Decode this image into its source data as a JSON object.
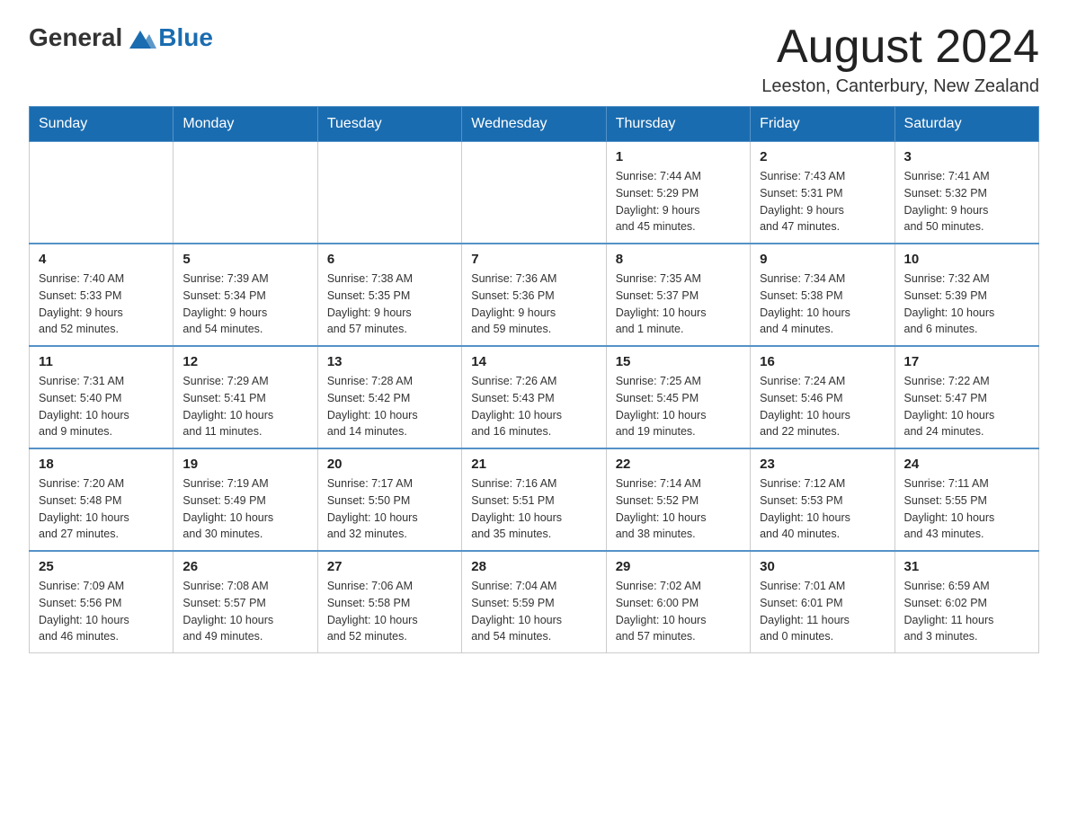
{
  "header": {
    "logo": {
      "general": "General",
      "blue": "Blue"
    },
    "title": "August 2024",
    "subtitle": "Leeston, Canterbury, New Zealand"
  },
  "weekdays": [
    "Sunday",
    "Monday",
    "Tuesday",
    "Wednesday",
    "Thursday",
    "Friday",
    "Saturday"
  ],
  "weeks": [
    [
      {
        "day": "",
        "info": ""
      },
      {
        "day": "",
        "info": ""
      },
      {
        "day": "",
        "info": ""
      },
      {
        "day": "",
        "info": ""
      },
      {
        "day": "1",
        "info": "Sunrise: 7:44 AM\nSunset: 5:29 PM\nDaylight: 9 hours\nand 45 minutes."
      },
      {
        "day": "2",
        "info": "Sunrise: 7:43 AM\nSunset: 5:31 PM\nDaylight: 9 hours\nand 47 minutes."
      },
      {
        "day": "3",
        "info": "Sunrise: 7:41 AM\nSunset: 5:32 PM\nDaylight: 9 hours\nand 50 minutes."
      }
    ],
    [
      {
        "day": "4",
        "info": "Sunrise: 7:40 AM\nSunset: 5:33 PM\nDaylight: 9 hours\nand 52 minutes."
      },
      {
        "day": "5",
        "info": "Sunrise: 7:39 AM\nSunset: 5:34 PM\nDaylight: 9 hours\nand 54 minutes."
      },
      {
        "day": "6",
        "info": "Sunrise: 7:38 AM\nSunset: 5:35 PM\nDaylight: 9 hours\nand 57 minutes."
      },
      {
        "day": "7",
        "info": "Sunrise: 7:36 AM\nSunset: 5:36 PM\nDaylight: 9 hours\nand 59 minutes."
      },
      {
        "day": "8",
        "info": "Sunrise: 7:35 AM\nSunset: 5:37 PM\nDaylight: 10 hours\nand 1 minute."
      },
      {
        "day": "9",
        "info": "Sunrise: 7:34 AM\nSunset: 5:38 PM\nDaylight: 10 hours\nand 4 minutes."
      },
      {
        "day": "10",
        "info": "Sunrise: 7:32 AM\nSunset: 5:39 PM\nDaylight: 10 hours\nand 6 minutes."
      }
    ],
    [
      {
        "day": "11",
        "info": "Sunrise: 7:31 AM\nSunset: 5:40 PM\nDaylight: 10 hours\nand 9 minutes."
      },
      {
        "day": "12",
        "info": "Sunrise: 7:29 AM\nSunset: 5:41 PM\nDaylight: 10 hours\nand 11 minutes."
      },
      {
        "day": "13",
        "info": "Sunrise: 7:28 AM\nSunset: 5:42 PM\nDaylight: 10 hours\nand 14 minutes."
      },
      {
        "day": "14",
        "info": "Sunrise: 7:26 AM\nSunset: 5:43 PM\nDaylight: 10 hours\nand 16 minutes."
      },
      {
        "day": "15",
        "info": "Sunrise: 7:25 AM\nSunset: 5:45 PM\nDaylight: 10 hours\nand 19 minutes."
      },
      {
        "day": "16",
        "info": "Sunrise: 7:24 AM\nSunset: 5:46 PM\nDaylight: 10 hours\nand 22 minutes."
      },
      {
        "day": "17",
        "info": "Sunrise: 7:22 AM\nSunset: 5:47 PM\nDaylight: 10 hours\nand 24 minutes."
      }
    ],
    [
      {
        "day": "18",
        "info": "Sunrise: 7:20 AM\nSunset: 5:48 PM\nDaylight: 10 hours\nand 27 minutes."
      },
      {
        "day": "19",
        "info": "Sunrise: 7:19 AM\nSunset: 5:49 PM\nDaylight: 10 hours\nand 30 minutes."
      },
      {
        "day": "20",
        "info": "Sunrise: 7:17 AM\nSunset: 5:50 PM\nDaylight: 10 hours\nand 32 minutes."
      },
      {
        "day": "21",
        "info": "Sunrise: 7:16 AM\nSunset: 5:51 PM\nDaylight: 10 hours\nand 35 minutes."
      },
      {
        "day": "22",
        "info": "Sunrise: 7:14 AM\nSunset: 5:52 PM\nDaylight: 10 hours\nand 38 minutes."
      },
      {
        "day": "23",
        "info": "Sunrise: 7:12 AM\nSunset: 5:53 PM\nDaylight: 10 hours\nand 40 minutes."
      },
      {
        "day": "24",
        "info": "Sunrise: 7:11 AM\nSunset: 5:55 PM\nDaylight: 10 hours\nand 43 minutes."
      }
    ],
    [
      {
        "day": "25",
        "info": "Sunrise: 7:09 AM\nSunset: 5:56 PM\nDaylight: 10 hours\nand 46 minutes."
      },
      {
        "day": "26",
        "info": "Sunrise: 7:08 AM\nSunset: 5:57 PM\nDaylight: 10 hours\nand 49 minutes."
      },
      {
        "day": "27",
        "info": "Sunrise: 7:06 AM\nSunset: 5:58 PM\nDaylight: 10 hours\nand 52 minutes."
      },
      {
        "day": "28",
        "info": "Sunrise: 7:04 AM\nSunset: 5:59 PM\nDaylight: 10 hours\nand 54 minutes."
      },
      {
        "day": "29",
        "info": "Sunrise: 7:02 AM\nSunset: 6:00 PM\nDaylight: 10 hours\nand 57 minutes."
      },
      {
        "day": "30",
        "info": "Sunrise: 7:01 AM\nSunset: 6:01 PM\nDaylight: 11 hours\nand 0 minutes."
      },
      {
        "day": "31",
        "info": "Sunrise: 6:59 AM\nSunset: 6:02 PM\nDaylight: 11 hours\nand 3 minutes."
      }
    ]
  ]
}
